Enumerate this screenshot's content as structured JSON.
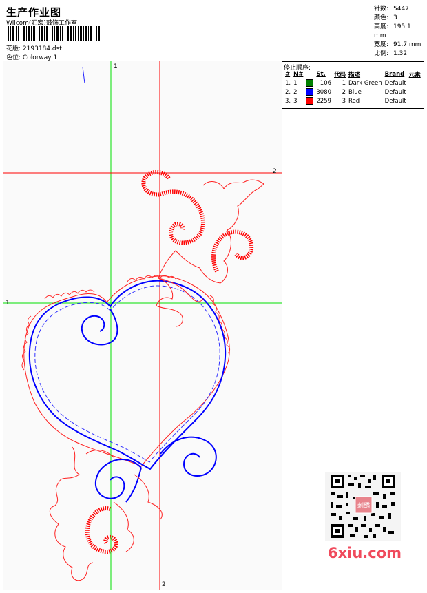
{
  "header": {
    "title": "生产作业图",
    "company": "Wilcom(汇宏)鼓饰工作室",
    "design_label": "花版:",
    "design_value": "2193184.dst",
    "colorway_label": "色位:",
    "colorway_value": "Colorway 1"
  },
  "stats": {
    "stitches_label": "针数:",
    "stitches": "5447",
    "colors_label": "颜色:",
    "colors": "3",
    "height_label": "高度:",
    "height": "195.1 mm",
    "width_label": "宽度:",
    "width": "91.7 mm",
    "scale_label": "比例:",
    "scale": "1.32"
  },
  "sequence": {
    "title": "停止顺序:",
    "headers": [
      "#",
      "N#",
      "St.",
      "代码",
      "描述",
      "Brand",
      "元素"
    ],
    "rows": [
      {
        "num": "1.",
        "n": "1",
        "color": "#008000",
        "st": "106",
        "code": "1",
        "desc": "Dark Green",
        "brand": "Default"
      },
      {
        "num": "2.",
        "n": "2",
        "color": "#0000ff",
        "st": "3080",
        "code": "2",
        "desc": "Blue",
        "brand": "Default"
      },
      {
        "num": "3.",
        "n": "3",
        "color": "#ff0000",
        "st": "2259",
        "code": "3",
        "desc": "Red",
        "brand": "Default"
      }
    ]
  },
  "axes": {
    "top": "1",
    "left": "1",
    "right": "2",
    "bottom": "2"
  },
  "watermark": {
    "text": "6xiu.com",
    "qr_stamp": "刺绣"
  },
  "colors": {
    "guide_green": "#00e000",
    "guide_red": "#ff0000",
    "thread_blue": "#0000ff",
    "thread_red": "#ff0000"
  }
}
